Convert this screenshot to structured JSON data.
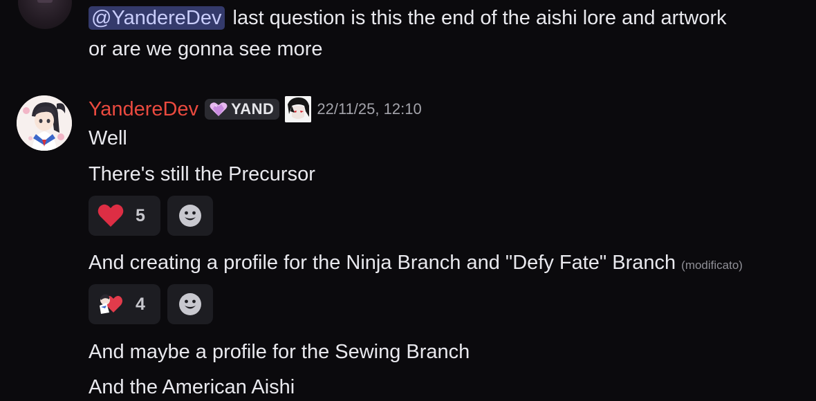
{
  "previous_message": {
    "mention": "@YandereDev",
    "text_line1": "last question is this the end of the aishi lore and artwork",
    "text_line2": "or are we gonna see more"
  },
  "message": {
    "author": "YandereDev",
    "author_color": "#ea4a3f",
    "guild_tag": "YAND",
    "timestamp": "22/11/25, 12:10",
    "lines": [
      {
        "text": "Well"
      },
      {
        "text": "There's still the Precursor",
        "reaction": {
          "emoji": "red-heart-icon",
          "count": "5"
        }
      },
      {
        "text": "And creating a profile for the Ninja Branch and \"Defy Fate\" Branch",
        "edited_label": "(modificato)",
        "reaction": {
          "emoji": "heart-hug-sticker-icon",
          "count": "4"
        }
      },
      {
        "text": "And maybe a profile for the Sewing Branch"
      },
      {
        "text": "And the American Aishi"
      }
    ]
  },
  "colors": {
    "background": "#0b0a0d",
    "mention_bg": "#343a6b",
    "reaction_bg": "#1d1d22"
  }
}
